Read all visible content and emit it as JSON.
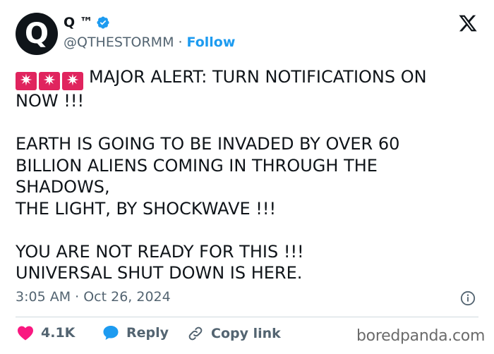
{
  "author": {
    "avatar_letter": "Q",
    "display_name": "Q ™",
    "handle": "@QTHESTORMM",
    "separator": "·",
    "follow_label": "Follow"
  },
  "icons": {
    "platform": "x-logo-icon",
    "verified": "verified-badge-icon",
    "siren": "police-car-light-icon",
    "info": "info-icon",
    "like": "heart-icon",
    "reply": "speech-bubble-icon",
    "copy": "link-icon"
  },
  "tweet": {
    "text": "MAJOR ALERT: TURN NOTIFICATIONS ON\nNOW !!!\n\nEARTH IS GOING TO BE INVADED BY OVER 60\nBILLION ALIENS COMING IN THROUGH THE\nSHADOWS,\nTHE LIGHT, BY SHOCKWAVE !!!\n\nYOU ARE NOT READY FOR THIS !!!\nUNIVERSAL SHUT DOWN IS HERE.",
    "timestamp": "3:05 AM · Oct 26, 2024"
  },
  "actions": {
    "like_count": "4.1K",
    "reply_label": "Reply",
    "copy_link_label": "Copy link"
  },
  "watermark": "boredpanda.com",
  "colors": {
    "accent": "#1d9bf0",
    "like": "#f91880",
    "siren": "#e0245e",
    "muted": "#536471"
  }
}
